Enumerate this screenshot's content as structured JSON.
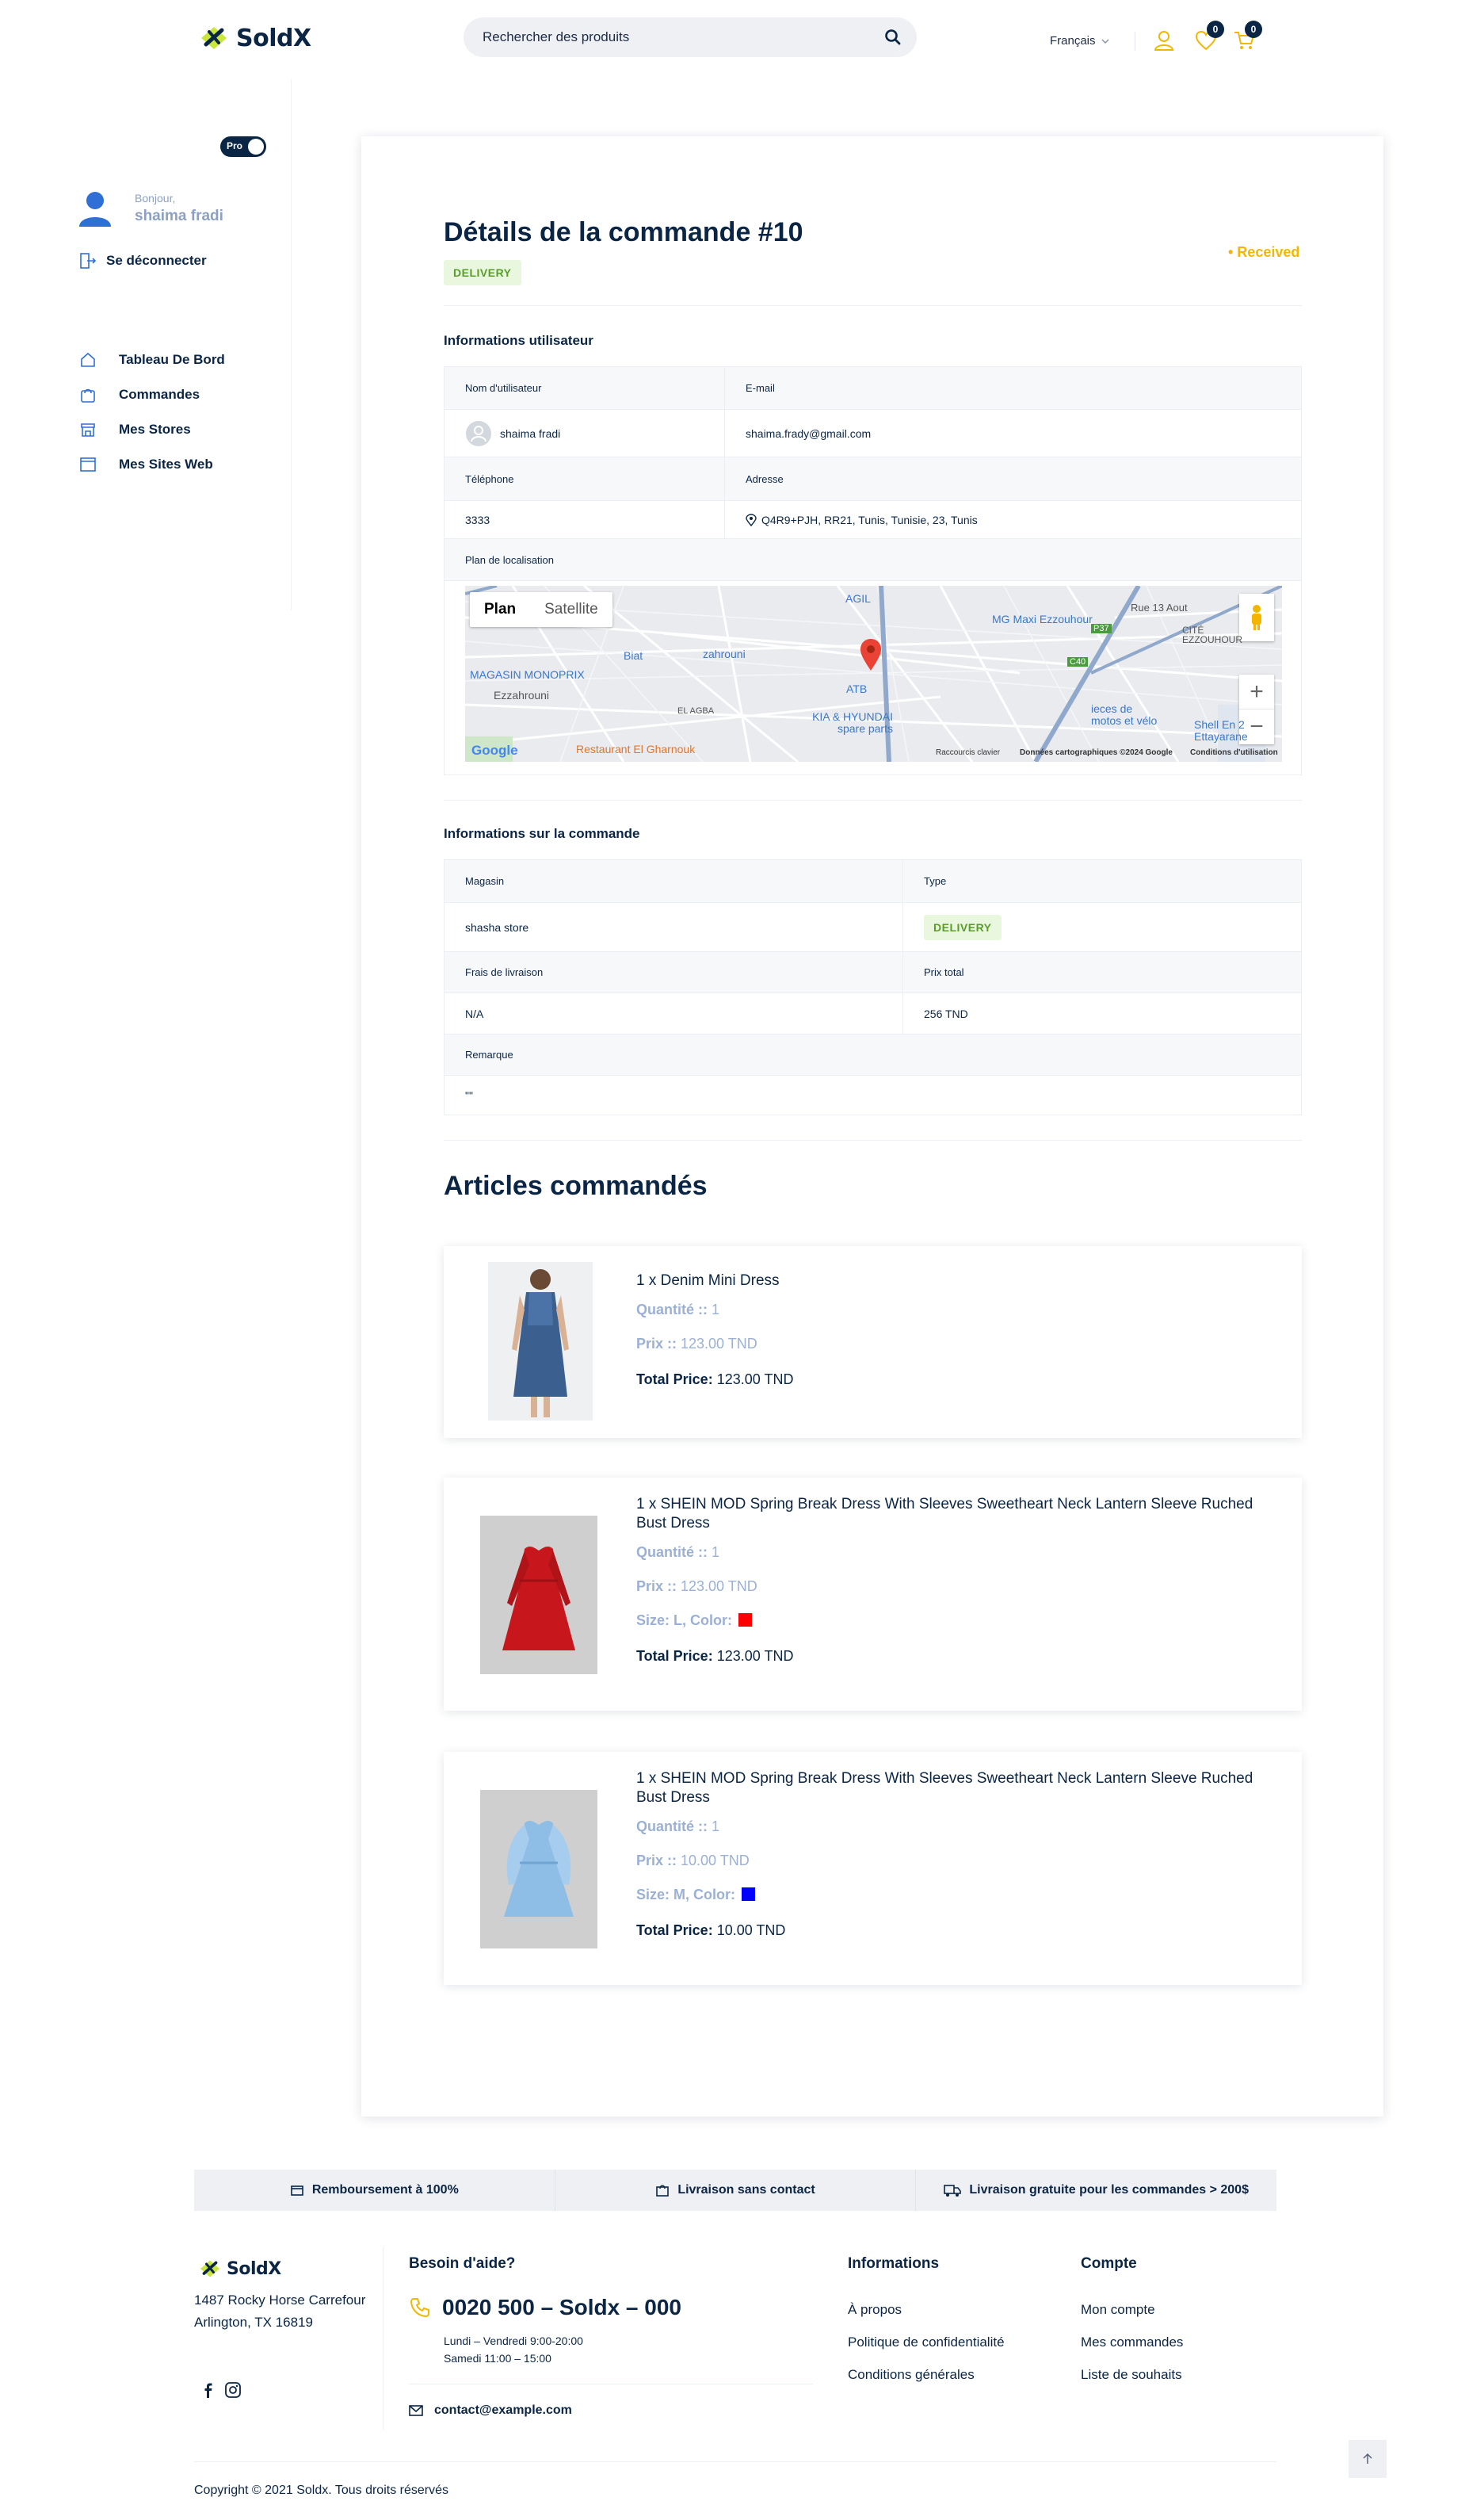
{
  "header": {
    "brand": "SoldX",
    "search_placeholder": "Rechercher des produits",
    "language": "Français",
    "wishlist_count": "0",
    "cart_count": "0"
  },
  "sidebar": {
    "pro_label": "Pro",
    "greeting": "Bonjour,",
    "user_name": "shaima fradi",
    "logout": "Se déconnecter",
    "items": [
      {
        "label": "Tableau De Bord",
        "icon": "home-icon"
      },
      {
        "label": "Commandes",
        "icon": "bag-icon"
      },
      {
        "label": "Mes Stores",
        "icon": "store-icon"
      },
      {
        "label": "Mes Sites Web",
        "icon": "browser-icon"
      }
    ]
  },
  "order": {
    "title": "Détails de la commande #10",
    "type_badge": "DELIVERY",
    "status": "• Received"
  },
  "user_info": {
    "title": "Informations utilisateur",
    "username_label": "Nom d'utilisateur",
    "username": "shaima fradi",
    "email_label": "E-mail",
    "email": "shaima.frady@gmail.com",
    "phone_label": "Téléphone",
    "phone": "3333",
    "address_label": "Adresse",
    "address": "Q4R9+PJH, RR21, Tunis, Tunisie, 23, Tunis",
    "map_label": "Plan de localisation"
  },
  "map": {
    "tab_plan": "Plan",
    "tab_satellite": "Satellite",
    "labels": {
      "agil": "AGIL",
      "mg": "MG Maxi Ezzouhour",
      "rue13": "Rue 13 Aout",
      "cite": "CITÉ EZZOUHOUR",
      "biat": "Biat",
      "zahrouni": "zahrouni",
      "monoprix": "MAGASIN MONOPRIX",
      "ezzahrouni": "Ezzahrouni",
      "elagba": "EL AGBA",
      "atb": "ATB",
      "kia": "KIA & HYUNDAI spare parts",
      "pieces": "ieces de motos et vélo",
      "shell": "Shell En 2 Ettayarane",
      "restaurant": "Restaurant El Gharnouk",
      "google": "Google",
      "shortcuts": "Raccourcis clavier",
      "mapdata": "Données cartographiques ©2024 Google",
      "terms": "Conditions d'utilisation",
      "road1": "P37",
      "road2": "C40"
    }
  },
  "order_info": {
    "title": "Informations sur la commande",
    "store_label": "Magasin",
    "store": "shasha store",
    "type_label": "Type",
    "type": "DELIVERY",
    "fee_label": "Frais de livraison",
    "fee": "N/A",
    "total_label": "Prix total",
    "total": "256 TND",
    "remark_label": "Remarque",
    "remark": "\"\""
  },
  "articles": {
    "title": "Articles commandés",
    "items": [
      {
        "name": "1 x Denim Mini Dress",
        "qty_label": "Quantité :: ",
        "qty": "1",
        "price_label": "Prix :: ",
        "price": "123.00 TND",
        "total_label": "Total Price:",
        "total": "123.00 TND"
      },
      {
        "name": "1 x SHEIN MOD Spring Break Dress With Sleeves Sweetheart Neck Lantern Sleeve Ruched Bust Dress",
        "qty_label": "Quantité :: ",
        "qty": "1",
        "price_label": "Prix :: ",
        "price": "123.00 TND",
        "size_label": "Size: L,  Color:",
        "color": "#ff0000",
        "total_label": "Total Price:",
        "total": "123.00 TND"
      },
      {
        "name": "1 x SHEIN MOD Spring Break Dress With Sleeves Sweetheart Neck Lantern Sleeve Ruched Bust Dress",
        "qty_label": "Quantité :: ",
        "qty": "1",
        "price_label": "Prix :: ",
        "price": "10.00 TND",
        "size_label": "Size: M,  Color:",
        "color": "#0000ff",
        "total_label": "Total Price:",
        "total": "10.00 TND"
      }
    ]
  },
  "footer": {
    "features": [
      "Remboursement à 100%",
      "Livraison sans contact",
      "Livraison gratuite pour les commandes > 200$"
    ],
    "brand": "SoldX",
    "address_line1": "1487 Rocky Horse Carrefour",
    "address_line2": "Arlington, TX 16819",
    "help_title": "Besoin d'aide?",
    "phone": "0020 500 – Soldx – 000",
    "hours_line1": "Lundi – Vendredi 9:00-20:00",
    "hours_line2": "Samedi 11:00 – 15:00",
    "email": "contact@example.com",
    "info_title": "Informations",
    "info_links": [
      "À propos",
      "Politique de confidentialité",
      "Conditions générales"
    ],
    "account_title": "Compte",
    "account_links": [
      "Mon compte",
      "Mes commandes",
      "Liste de souhaits"
    ],
    "copyright": "Copyright © 2021 Soldx. Tous droits réservés"
  },
  "colors": {
    "navy": "#0b2545",
    "accent_yellow": "#f2b705",
    "brand_blue": "#2f6fd6",
    "delivery_green": "#5a9e2a",
    "muted_blue": "#9bb0d3"
  }
}
